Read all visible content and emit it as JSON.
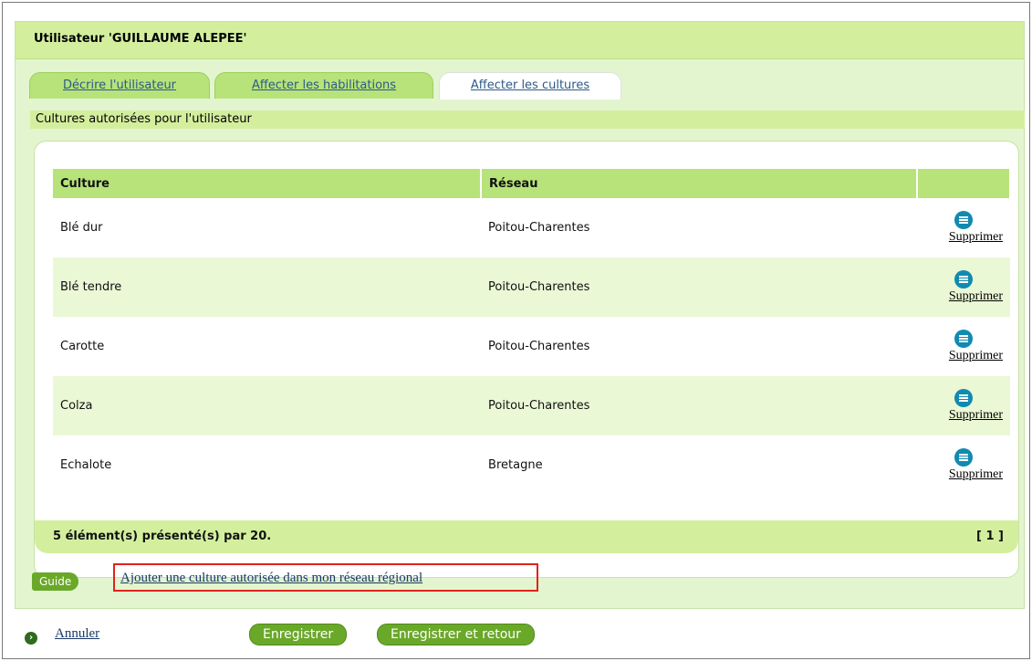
{
  "header": {
    "title": "Utilisateur 'GUILLAUME ALEPEE'"
  },
  "tabs": [
    {
      "label": "Décrire l'utilisateur",
      "active": false
    },
    {
      "label": "Affecter les habilitations",
      "active": false
    },
    {
      "label": "Affecter les cultures",
      "active": true
    }
  ],
  "section": {
    "title": "Cultures autorisées pour l'utilisateur"
  },
  "table": {
    "columns": [
      "Culture",
      "Réseau",
      ""
    ],
    "rows": [
      {
        "culture": "Blé dur",
        "reseau": "Poitou-Charentes",
        "action": "Supprimer"
      },
      {
        "culture": "Blé tendre",
        "reseau": "Poitou-Charentes",
        "action": "Supprimer"
      },
      {
        "culture": "Carotte",
        "reseau": "Poitou-Charentes",
        "action": "Supprimer"
      },
      {
        "culture": "Colza",
        "reseau": "Poitou-Charentes",
        "action": "Supprimer"
      },
      {
        "culture": "Echalote",
        "reseau": "Bretagne",
        "action": "Supprimer"
      }
    ],
    "footer_count": "5 élément(s) présenté(s) par 20.",
    "pagination": "[ 1 ]"
  },
  "guide": {
    "label": "Guide"
  },
  "add_link": {
    "label": "Ajouter une culture autorisée dans mon réseau régional"
  },
  "actions": {
    "cancel": "Annuler",
    "save": "Enregistrer",
    "save_return": "Enregistrer et retour"
  },
  "colors": {
    "header_green": "#d3ef9e",
    "tab_green": "#b7e37a",
    "button_green": "#6aa82a",
    "highlight_red": "#e0231c",
    "icon_blue": "#118ab0"
  }
}
